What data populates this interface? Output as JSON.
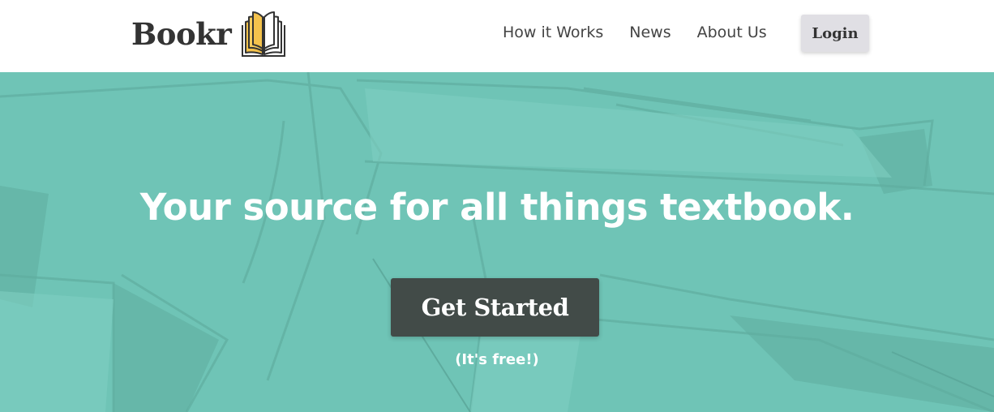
{
  "header": {
    "brand_name": "Bookr",
    "logo_icon": "open-book-icon",
    "nav_links": [
      "How it Works",
      "News",
      "About Us"
    ],
    "login_label": "Login"
  },
  "hero": {
    "headline": "Your source for all things textbook.",
    "cta_label": "Get Started",
    "cta_note": "(It's free!)",
    "background_image": "books-photo"
  },
  "colors": {
    "hero_teal": "#6fc4b6",
    "cta_background": "#424b48",
    "login_background": "#e0dfe4",
    "logo_accent": "#f4c24c",
    "text_dark": "#333333"
  }
}
